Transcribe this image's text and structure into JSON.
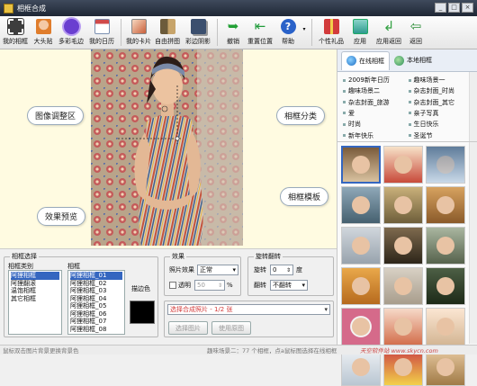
{
  "window": {
    "title": "相框合成"
  },
  "toolbar": [
    {
      "label": "我的相框",
      "icon": "film-frame-icon",
      "color": "#3d3d3d"
    },
    {
      "label": "大头贴",
      "icon": "sticker-face-icon",
      "color": "#e07d2c"
    },
    {
      "label": "多彩毛边",
      "icon": "colorful-edge-icon",
      "color": "#6a3fd0"
    },
    {
      "label": "我的日历",
      "icon": "calendar-icon",
      "color": "#7a8fb0"
    },
    {
      "label": "我的卡片",
      "icon": "card-icon",
      "color": "#c95f3a"
    },
    {
      "label": "自由拼图",
      "icon": "puzzle-icon",
      "color": "#6c5b3b"
    },
    {
      "label": "彩边阴影",
      "icon": "shadow-border-icon",
      "color": "#3b4f6e"
    },
    {
      "label": "撤销",
      "icon": "undo-icon",
      "color": "#22a035"
    },
    {
      "label": "重置位置",
      "icon": "reset-position-icon",
      "color": "#1f9b3a"
    },
    {
      "label": "帮助",
      "icon": "help-icon",
      "color": "#2a62c9"
    },
    {
      "label": "个性礼品",
      "icon": "gift-icon",
      "color": "#d23b3b"
    },
    {
      "label": "应用",
      "icon": "apply-icon",
      "color": "#2e9a8f"
    },
    {
      "label": "应用返回",
      "icon": "apply-return-icon",
      "color": "#31a041"
    },
    {
      "label": "返回",
      "icon": "back-icon",
      "color": "#2d8f38"
    }
  ],
  "canvas": {
    "callouts": {
      "adjust": "图像调整区",
      "preview": "效果预览",
      "category": "相框分类",
      "template": "相框模板"
    }
  },
  "right_panel": {
    "tabs": [
      "在线相框",
      "本地相框"
    ],
    "categories": [
      "2009新年日历",
      "趣味场景一",
      "趣味场景二",
      "杂志封面_时尚",
      "杂志封面_旅游",
      "杂志封面_其它",
      "爱",
      "亲子写真",
      "时尚",
      "生日快乐",
      "新年快乐",
      "圣诞节"
    ]
  },
  "frame_select": {
    "title": "相框选择",
    "category_header": "相框类别",
    "categories": [
      "阿狸相框",
      "阿狸翻滚",
      "温饱相框",
      "其它相框"
    ],
    "frame_header": "相框",
    "frames": [
      "阿狸相框_01",
      "阿狸相框_02",
      "阿狸相框_03",
      "阿狸相框_04",
      "阿狸相框_05",
      "阿狸相框_06",
      "阿狸相框_07",
      "阿狸相框_08"
    ],
    "edge_color_label": "描边色",
    "edge_color": "#000000"
  },
  "effect": {
    "title": "效果",
    "photo_effect_label": "照片效果",
    "photo_effect_value": "正常",
    "transparent_label": "透明",
    "transparent_value": "50",
    "transparent_unit": "%"
  },
  "rotate": {
    "title": "旋转翻转",
    "rotate_label": "旋转",
    "rotate_value": "0",
    "rotate_unit": "度",
    "flip_label": "翻转",
    "flip_value": "不翻转"
  },
  "compose": {
    "header": "选择合成照片 - 1/2 张",
    "select_button": "选择图片",
    "use_button": "使用原图"
  },
  "status": {
    "left": "鼠标双击图片背景更换背景色",
    "right": "趣味场景二：77 个相框，点a鼠标图选择在线相框",
    "watermark": "天空软件站 www.skycn.com"
  }
}
